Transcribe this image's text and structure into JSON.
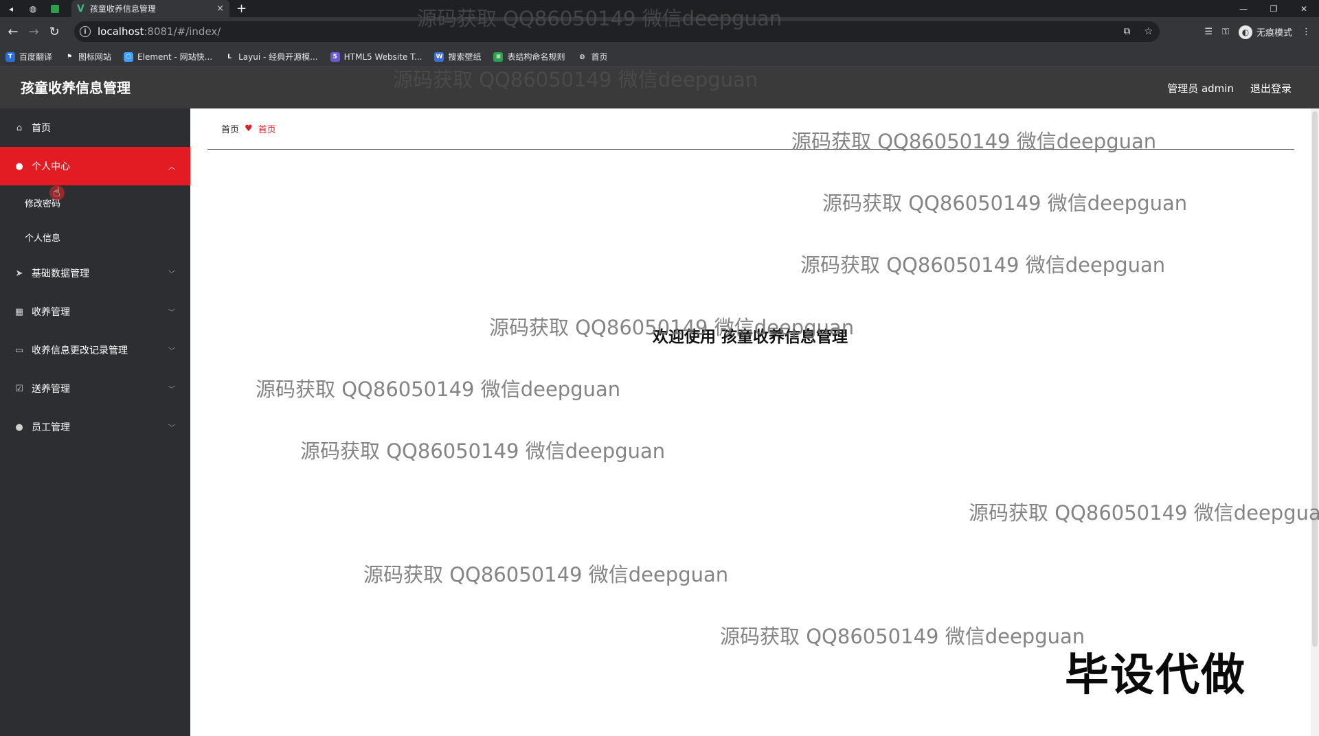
{
  "browser": {
    "tab_title": "孩童收养信息管理",
    "tab_favicon": "V",
    "tab_close": "×",
    "new_tab": "+",
    "url_host": "localhost",
    "url_path": ":8081/#/index/",
    "incognito_label": "无痕模式",
    "bookmarks": [
      {
        "label": "百度翻译",
        "icon": "baidu-translate-icon",
        "color": "#2b6fd6",
        "glyph": "T"
      },
      {
        "label": "图标网站",
        "icon": "flag-icon",
        "color": "#35363a",
        "glyph": "⚑"
      },
      {
        "label": "Element - 网站快...",
        "icon": "element-icon",
        "color": "#409eff",
        "glyph": "⬡"
      },
      {
        "label": "Layui - 经典开源模...",
        "icon": "layui-icon",
        "color": "#35363a",
        "glyph": "L"
      },
      {
        "label": "HTML5 Website T...",
        "icon": "html5-icon",
        "color": "#6a5acd",
        "glyph": "5"
      },
      {
        "label": "搜索壁纸",
        "icon": "wallpaper-icon",
        "color": "#3a6fd8",
        "glyph": "W"
      },
      {
        "label": "表结构命名规则",
        "icon": "table-icon",
        "color": "#2e9e4f",
        "glyph": "≡"
      },
      {
        "label": "首页",
        "icon": "globe-icon",
        "color": "#35363a",
        "glyph": "◍"
      }
    ]
  },
  "header": {
    "app_title": "孩童收养信息管理",
    "user_label": "管理员 admin",
    "logout_label": "退出登录"
  },
  "sidebar": {
    "items": [
      {
        "label": "首页",
        "icon": "home-icon",
        "active": false,
        "has_arrow": false
      },
      {
        "label": "个人中心",
        "icon": "user-icon",
        "active": true,
        "has_arrow": true,
        "children": [
          "修改密码",
          "个人信息"
        ]
      },
      {
        "label": "基础数据管理",
        "icon": "paper-plane-icon",
        "active": false,
        "has_arrow": true
      },
      {
        "label": "收养管理",
        "icon": "grid-icon",
        "active": false,
        "has_arrow": true
      },
      {
        "label": "收养信息更改记录管理",
        "icon": "message-icon",
        "active": false,
        "has_arrow": true
      },
      {
        "label": "送养管理",
        "icon": "checkbox-icon",
        "active": false,
        "has_arrow": true
      },
      {
        "label": "员工管理",
        "icon": "user-icon",
        "active": false,
        "has_arrow": true
      }
    ]
  },
  "breadcrumb": {
    "root": "首页",
    "current": "首页"
  },
  "main": {
    "welcome": "欢迎使用 孩童收养信息管理"
  },
  "watermark": {
    "text": "源码获取 QQ86050149 微信deepguan",
    "badge": "毕设代做"
  },
  "colors": {
    "accent": "#e31b23",
    "sidebar_bg": "#2d2e31",
    "header_bg": "#3a3a3a"
  }
}
